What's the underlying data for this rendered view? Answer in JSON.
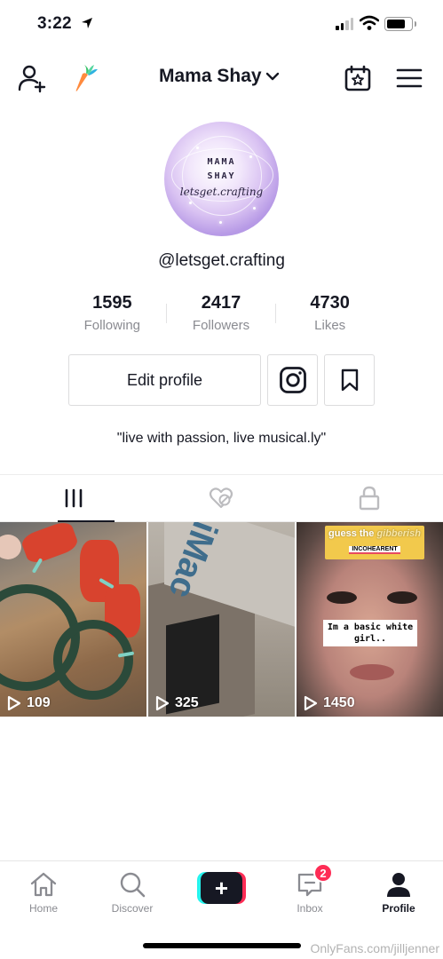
{
  "status_bar": {
    "time": "3:22",
    "battery_level": 0.75
  },
  "header": {
    "username": "Mama Shay"
  },
  "avatar": {
    "line1": "MAMA",
    "line2": "SHAY",
    "line3": "letsget.crafting"
  },
  "profile": {
    "handle": "@letsget.crafting",
    "bio": "\"live with passion, live musical.ly\""
  },
  "stats": [
    {
      "value": "1595",
      "label": "Following"
    },
    {
      "value": "2417",
      "label": "Followers"
    },
    {
      "value": "4730",
      "label": "Likes"
    }
  ],
  "buttons": {
    "edit_profile": "Edit profile"
  },
  "videos": [
    {
      "views": "109"
    },
    {
      "views": "325",
      "overlay_text": "iMac"
    },
    {
      "views": "1450",
      "title_prefix": "guess the ",
      "title_emph": "gibberish",
      "tag": "INCOHEARENT",
      "caption": "Im a basic white girl.."
    }
  ],
  "bottom_nav": {
    "items": [
      {
        "label": "Home",
        "icon": "home-icon"
      },
      {
        "label": "Discover",
        "icon": "search-icon"
      },
      {
        "label": "Inbox",
        "icon": "inbox-icon",
        "badge": "2"
      },
      {
        "label": "Profile",
        "icon": "profile-icon"
      }
    ]
  },
  "watermark": "OnlyFans.com/jilljenner",
  "colors": {
    "text": "#161823",
    "secondary": "#8a8b91",
    "accent_pink": "#fe2c55",
    "accent_cyan": "#25f4ee"
  }
}
